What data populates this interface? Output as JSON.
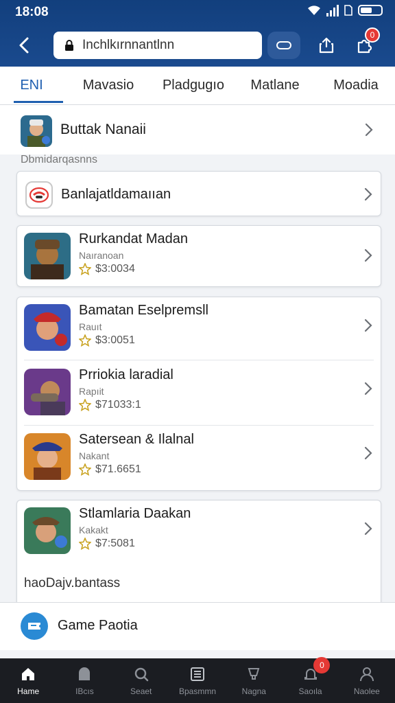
{
  "status_bar": {
    "time": "18:08"
  },
  "browser": {
    "url": "Inchlkırnnantlnn",
    "notification_count": "0"
  },
  "tabs": [
    {
      "label": "ENI",
      "active": true
    },
    {
      "label": "Mavasio",
      "active": false
    },
    {
      "label": "Pladgugıo",
      "active": false
    },
    {
      "label": "Matlane",
      "active": false
    },
    {
      "label": "Moadia",
      "active": false
    }
  ],
  "featured": {
    "title": "Buttak Nanaii"
  },
  "section_label": "Dbmidarqasnns",
  "single_row": {
    "title": "Banlajatldamaııan"
  },
  "games_group_1": [
    {
      "title": "Rurkandat Madan",
      "subtitle": "Naıranoan",
      "price": "$3:0034"
    }
  ],
  "games_group_2": [
    {
      "title": "Bamatan Eselpremsll",
      "subtitle": "Rauıt",
      "price": "$3:0051"
    },
    {
      "title": "Prriokia laradial",
      "subtitle": "Rapıit",
      "price": "$71033:1"
    },
    {
      "title": "Satersean & Ilalnal",
      "subtitle": "Nakant",
      "price": "$71.6651"
    }
  ],
  "games_group_3": [
    {
      "title": "Stlamlaria Daakan",
      "subtitle": "Kakakt",
      "price": "$7:5081"
    }
  ],
  "card_footer_text": "haoDajv.bantass",
  "promo": {
    "title": "Game Paotia"
  },
  "bottom_nav": {
    "items": [
      {
        "label": "Hame",
        "icon": "home-icon",
        "active": true
      },
      {
        "label": "IBcıs",
        "icon": "store-icon",
        "active": false
      },
      {
        "label": "Seaet",
        "icon": "search-icon",
        "active": false
      },
      {
        "label": "Bpasmmn",
        "icon": "list-icon",
        "active": false
      },
      {
        "label": "Nagna",
        "icon": "trophy-icon",
        "active": false
      },
      {
        "label": "Saoıla",
        "icon": "bell-icon",
        "active": false,
        "badge": "0"
      },
      {
        "label": "Naolee",
        "icon": "profile-icon",
        "active": false
      }
    ]
  },
  "colors": {
    "header": "#1a4a8e",
    "accent": "#1f5fb0",
    "badge": "#e53935",
    "nav_bg": "#1b1d22"
  }
}
